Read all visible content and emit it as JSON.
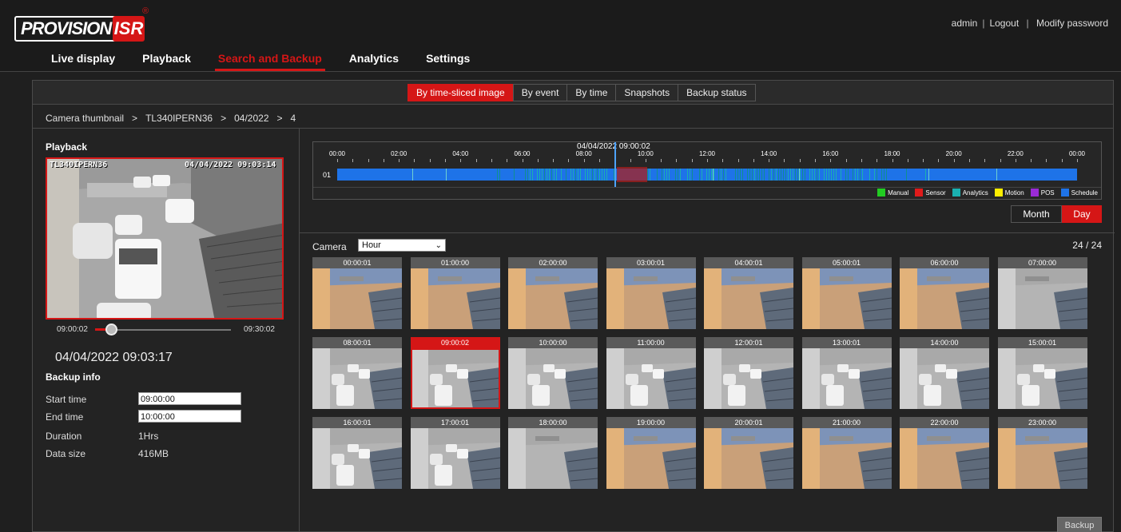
{
  "header": {
    "logo_left": "PROVISION",
    "logo_right": "ISR",
    "logo_reg": "®",
    "user": "admin",
    "logout": "Logout",
    "modify_password": "Modify password",
    "nav": [
      "Live display",
      "Playback",
      "Search and Backup",
      "Analytics",
      "Settings"
    ],
    "nav_active": "Search and Backup"
  },
  "tabs": [
    "By time-sliced image",
    "By event",
    "By time",
    "Snapshots",
    "Backup status"
  ],
  "tabs_active": "By time-sliced image",
  "breadcrumb": [
    "Camera thumbnail",
    ">",
    "TL340IPERN36",
    ">",
    "04/2022",
    ">",
    "4"
  ],
  "playback": {
    "title": "Playback",
    "osd_left": "TL340IPERN36",
    "osd_right": "04/04/2022 09:03:14",
    "slider_start": "09:00:02",
    "slider_end": "09:30:02",
    "slider_progress": 0.12,
    "current_time": "04/04/2022 09:03:17"
  },
  "backup_info": {
    "title": "Backup info",
    "start_label": "Start time",
    "start_value": "09:00:00",
    "end_label": "End time",
    "end_value": "10:00:00",
    "duration_label": "Duration",
    "duration_value": "1Hrs",
    "size_label": "Data size",
    "size_value": "416MB"
  },
  "timeline": {
    "caption": "04/04/2022 09:00:02",
    "channel": "01",
    "hours": [
      "00:00",
      "02:00",
      "04:00",
      "06:00",
      "08:00",
      "10:00",
      "12:00",
      "14:00",
      "16:00",
      "18:00",
      "20:00",
      "22:00",
      "00:00"
    ],
    "legend": [
      {
        "label": "Manual",
        "color": "#22cc22"
      },
      {
        "label": "Sensor",
        "color": "#e01b1b"
      },
      {
        "label": "Analytics",
        "color": "#1ab0b0"
      },
      {
        "label": "Motion",
        "color": "#ffee00"
      },
      {
        "label": "POS",
        "color": "#9a2bd6"
      },
      {
        "label": "Schedule",
        "color": "#1e73e8"
      }
    ]
  },
  "view_toggle": {
    "month": "Month",
    "day": "Day",
    "active": "Day"
  },
  "camera": {
    "label": "Camera",
    "select_value": "Hour",
    "count": "24 / 24"
  },
  "thumbnails": [
    "00:00:01",
    "01:00:00",
    "02:00:00",
    "03:00:01",
    "04:00:01",
    "05:00:01",
    "06:00:00",
    "07:00:00",
    "08:00:01",
    "09:00:02",
    "10:00:00",
    "11:00:00",
    "12:00:01",
    "13:00:01",
    "14:00:00",
    "15:00:01",
    "16:00:01",
    "17:00:01",
    "18:00:00",
    "19:00:00",
    "20:00:01",
    "21:00:00",
    "22:00:00",
    "23:00:00"
  ],
  "thumbnail_selected": "09:00:02",
  "backup_button": "Backup"
}
